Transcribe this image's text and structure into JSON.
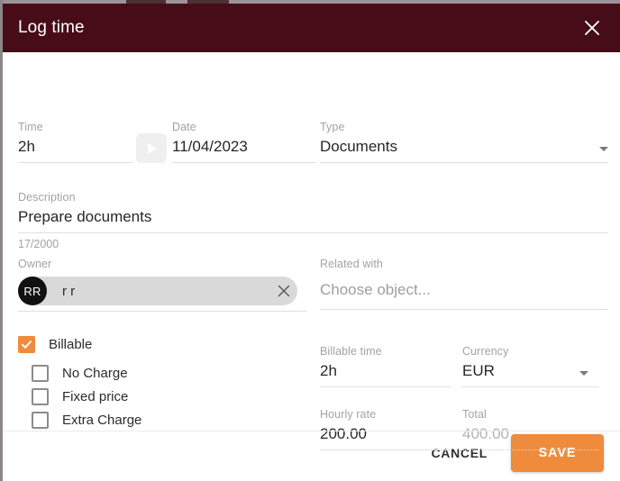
{
  "dialog": {
    "title": "Log time",
    "close_icon": "close-icon"
  },
  "fields": {
    "time": {
      "label": "Time",
      "value": "2h"
    },
    "date": {
      "label": "Date",
      "value": "11/04/2023"
    },
    "type": {
      "label": "Type",
      "value": "Documents",
      "caret_icon": "chevron-down-icon"
    },
    "description": {
      "label": "Description",
      "value": "Prepare documents",
      "counter": "17/2000"
    },
    "owner": {
      "label": "Owner",
      "avatar_initials": "RR",
      "chip_text": "r r",
      "clear_icon": "close-icon"
    },
    "related_with": {
      "label": "Related with",
      "placeholder": "Choose object..."
    },
    "billable_time": {
      "label": "Billable time",
      "value": "2h"
    },
    "currency": {
      "label": "Currency",
      "value": "EUR",
      "caret_icon": "chevron-down-icon"
    },
    "hourly_rate": {
      "label": "Hourly rate",
      "value": "200.00"
    },
    "total": {
      "label": "Total",
      "value": "400.00"
    }
  },
  "checkboxes": {
    "billable": {
      "label": "Billable",
      "checked": true
    },
    "no_charge": {
      "label": "No Charge",
      "checked": false
    },
    "fixed_price": {
      "label": "Fixed price",
      "checked": false
    },
    "extra_charge": {
      "label": "Extra Charge",
      "checked": false
    }
  },
  "footer": {
    "cancel_label": "CANCEL",
    "save_label": "SAVE"
  },
  "colors": {
    "header": "#460d19",
    "accent": "#ef8b3c",
    "avatar": "#111111"
  }
}
